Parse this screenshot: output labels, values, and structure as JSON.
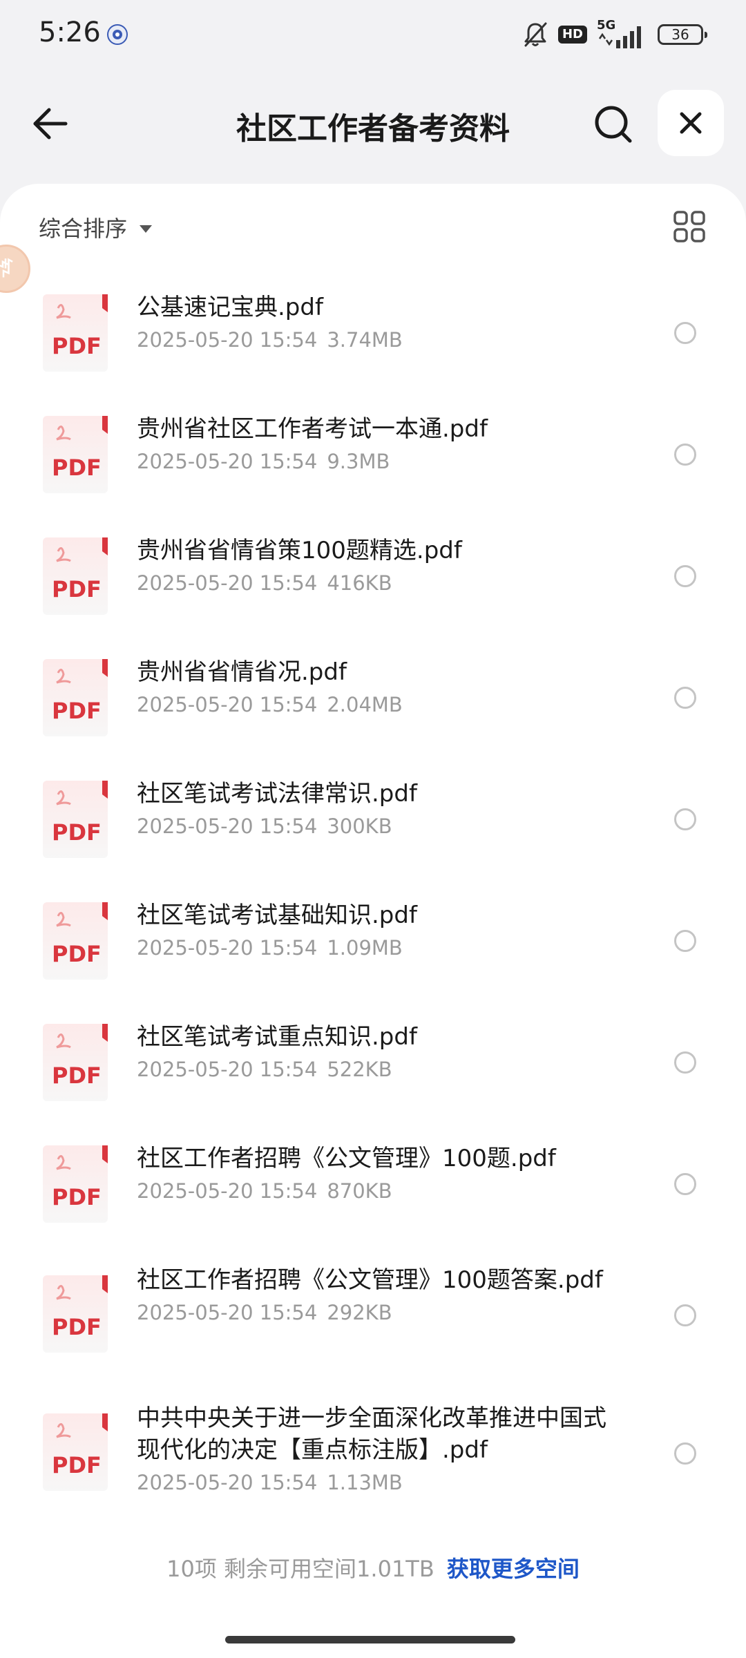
{
  "status_bar": {
    "time": "5:26",
    "hd": "HD",
    "network": "5G",
    "battery": "36"
  },
  "header": {
    "title": "社区工作者备考资料"
  },
  "toolbar": {
    "sort_label": "综合排序"
  },
  "floating_badge": {
    "glyph": "ꆶ"
  },
  "files": [
    {
      "name": "公基速记宝典.pdf",
      "date": "2025-05-20 15:54",
      "size": "3.74MB",
      "icon_label": "PDF"
    },
    {
      "name": "贵州省社区工作者考试一本通.pdf",
      "date": "2025-05-20 15:54",
      "size": "9.3MB",
      "icon_label": "PDF"
    },
    {
      "name": "贵州省省情省策100题精选.pdf",
      "date": "2025-05-20 15:54",
      "size": "416KB",
      "icon_label": "PDF"
    },
    {
      "name": "贵州省省情省况.pdf",
      "date": "2025-05-20 15:54",
      "size": "2.04MB",
      "icon_label": "PDF"
    },
    {
      "name": "社区笔试考试法律常识.pdf",
      "date": "2025-05-20 15:54",
      "size": "300KB",
      "icon_label": "PDF"
    },
    {
      "name": "社区笔试考试基础知识.pdf",
      "date": "2025-05-20 15:54",
      "size": "1.09MB",
      "icon_label": "PDF"
    },
    {
      "name": "社区笔试考试重点知识.pdf",
      "date": "2025-05-20 15:54",
      "size": "522KB",
      "icon_label": "PDF"
    },
    {
      "name": "社区工作者招聘《公文管理》100题.pdf",
      "date": "2025-05-20 15:54",
      "size": "870KB",
      "icon_label": "PDF"
    },
    {
      "name": "社区工作者招聘《公文管理》100题答案.pdf",
      "date": "2025-05-20 15:54",
      "size": "292KB",
      "icon_label": "PDF"
    },
    {
      "name": "中共中央关于进一步全面深化改革推进中国式现代化的决定【重点标注版】.pdf",
      "date": "2025-05-20 15:54",
      "size": "1.13MB",
      "icon_label": "PDF"
    }
  ],
  "footer": {
    "count_text": "10项 剩余可用空间1.01TB",
    "link_text": "获取更多空间"
  },
  "colors": {
    "accent": "#1e57c8",
    "pdf_red": "#d9363e",
    "meta_gray": "#9a9a9a"
  }
}
